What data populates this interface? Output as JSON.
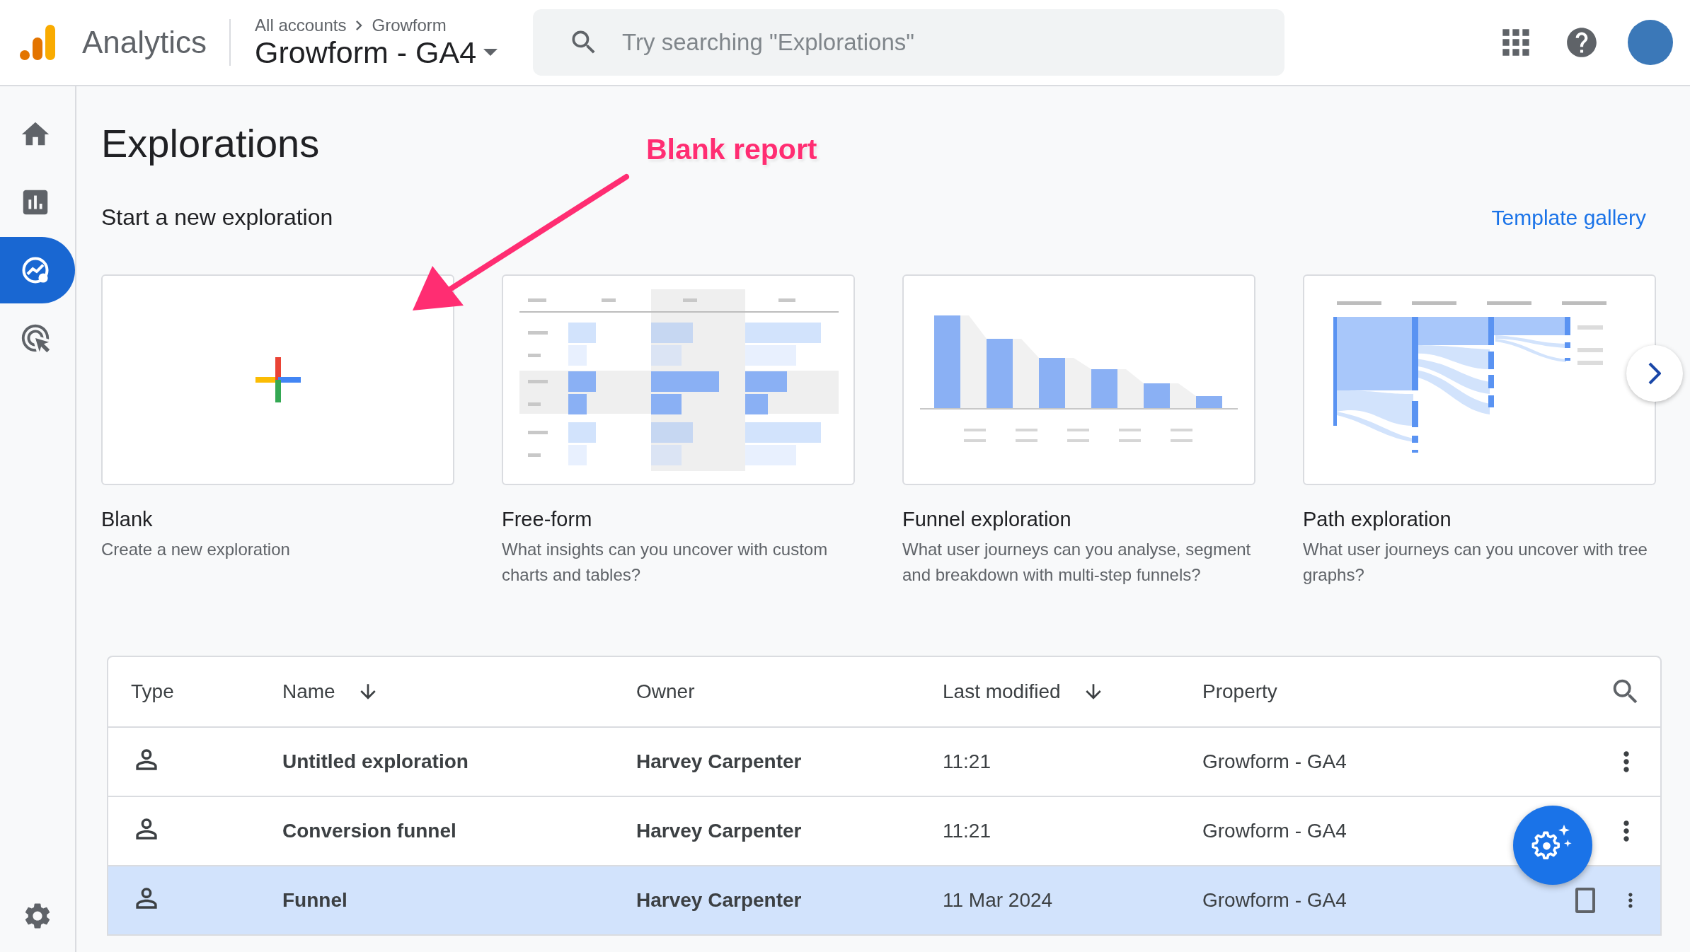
{
  "topbar": {
    "product": "Analytics",
    "breadcrumb": [
      "All accounts",
      "Growform"
    ],
    "property": "Growform - GA4",
    "search": {
      "placeholder": "Try searching \"Explorations\""
    }
  },
  "sidebar": {
    "items": [
      {
        "kind": "home",
        "selected": false
      },
      {
        "kind": "reports",
        "selected": false
      },
      {
        "kind": "explore",
        "selected": true
      },
      {
        "kind": "advertising",
        "selected": false
      }
    ]
  },
  "page": {
    "title": "Explorations",
    "annotation": "Blank report",
    "section_title": "Start a new exploration",
    "template_link": "Template gallery"
  },
  "templates": [
    {
      "kind": "blank",
      "title": "Blank",
      "description": "Create a new exploration"
    },
    {
      "kind": "freeform",
      "title": "Free-form",
      "description": "What insights can you uncover with custom charts and tables?"
    },
    {
      "kind": "funnel",
      "title": "Funnel exploration",
      "description": "What user journeys can you analyse, segment and breakdown with multi-step funnels?"
    },
    {
      "kind": "path",
      "title": "Path exploration",
      "description": "What user journeys can you uncover with tree graphs?"
    }
  ],
  "table": {
    "columns": [
      {
        "label": "Type",
        "sorted": false
      },
      {
        "label": "Name",
        "sorted": true
      },
      {
        "label": "Owner",
        "sorted": false
      },
      {
        "label": "Last modified",
        "sorted": true
      },
      {
        "label": "Property",
        "sorted": false
      }
    ],
    "rows": [
      {
        "name": "Untitled exploration",
        "owner": "Harvey Carpenter",
        "last_modified": "11:21",
        "property": "Growform - GA4",
        "selected": false,
        "checked": false
      },
      {
        "name": "Conversion funnel",
        "owner": "Harvey Carpenter",
        "last_modified": "11:21",
        "property": "Growform - GA4",
        "selected": false,
        "checked": false
      },
      {
        "name": "Funnel",
        "owner": "Harvey Carpenter",
        "last_modified": "11 Mar 2024",
        "property": "Growform - GA4",
        "selected": true,
        "checked": false
      }
    ]
  }
}
